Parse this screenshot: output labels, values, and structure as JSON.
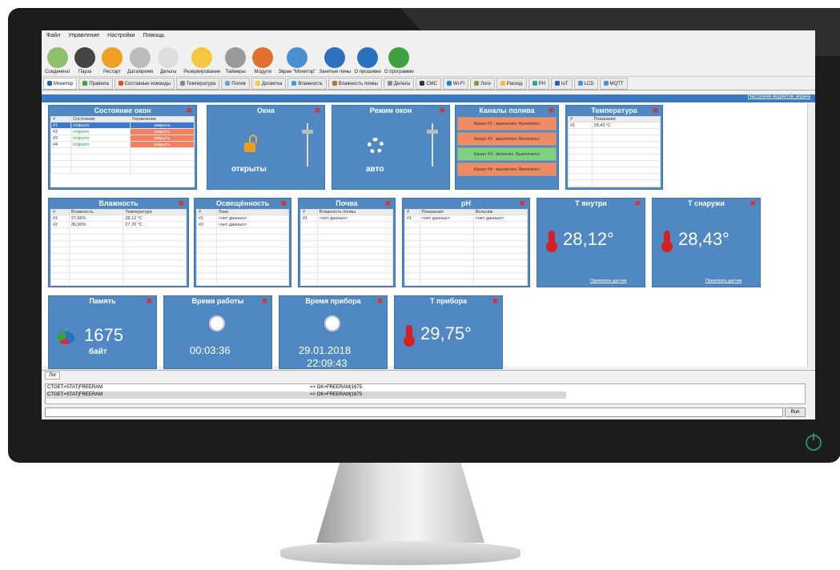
{
  "menu": [
    "Файл",
    "Управление",
    "Настройки",
    "Помощь"
  ],
  "toolbar": [
    {
      "label": "Соединено",
      "icon": "plug-icon",
      "color": "#8fbf6a"
    },
    {
      "label": "Пауза",
      "icon": "pause-icon",
      "color": "#444444"
    },
    {
      "label": "Рестарт",
      "icon": "restart-icon",
      "color": "#f0a020"
    },
    {
      "label": "Дата/время",
      "icon": "alarm-clock-icon",
      "color": "#bbbbbb"
    },
    {
      "label": "Дельты",
      "icon": "document-icon",
      "color": "#dddddd"
    },
    {
      "label": "Резервирование",
      "icon": "folder-icon",
      "color": "#f5c842"
    },
    {
      "label": "Таймеры",
      "icon": "timer-icon",
      "color": "#999999"
    },
    {
      "label": "Модули",
      "icon": "tools-icon",
      "color": "#e07030"
    },
    {
      "label": "Экран \"Монитор\"",
      "icon": "monitor-icon",
      "color": "#4a90d0"
    },
    {
      "label": "Занятые пины",
      "icon": "pin-icon",
      "color": "#3070c0"
    },
    {
      "label": "О прошивке",
      "icon": "info-icon",
      "color": "#2a70c0"
    },
    {
      "label": "О программе",
      "icon": "leaf-icon",
      "color": "#3fa040"
    }
  ],
  "tabs": [
    {
      "label": "Монитор",
      "color": "#2a5fb0"
    },
    {
      "label": "Правила",
      "color": "#40a040"
    },
    {
      "label": "Составные команды",
      "color": "#e05020"
    },
    {
      "label": "Температура",
      "color": "#888888"
    },
    {
      "label": "Полив",
      "color": "#6a9fe0"
    },
    {
      "label": "Досветка",
      "color": "#f0d030"
    },
    {
      "label": "Влажность",
      "color": "#3aa0e0"
    },
    {
      "label": "Влажность почвы",
      "color": "#b07030"
    },
    {
      "label": "Дельты",
      "color": "#888888"
    },
    {
      "label": "СМС",
      "color": "#333333"
    },
    {
      "label": "Wi-Fi",
      "color": "#2080d0"
    },
    {
      "label": "Логи",
      "color": "#80a040"
    },
    {
      "label": "Расход",
      "color": "#f0c030"
    },
    {
      "label": "PH",
      "color": "#30a0a0"
    },
    {
      "label": "IoT",
      "color": "#2060c0"
    },
    {
      "label": "LCD",
      "color": "#4a90d0"
    },
    {
      "label": "MQTT",
      "color": "#4a90d0"
    }
  ],
  "dash_link": "Настройки виджетов экрана",
  "window_state": {
    "title": "Состояние окон",
    "headers": [
      "#",
      "Состояние",
      "Управление"
    ],
    "rows": [
      [
        "#1",
        "открыто",
        "закрыть"
      ],
      [
        "#2",
        "открыто",
        "закрыть"
      ],
      [
        "#3",
        "открыто",
        "закрыть"
      ],
      [
        "#4",
        "открыто",
        "закрыть"
      ]
    ]
  },
  "windows": {
    "title": "Окна",
    "value": "открыты"
  },
  "window_mode": {
    "title": "Режим окон",
    "value": "авто"
  },
  "watering": {
    "title": "Каналы полива",
    "channels": [
      {
        "label": "Канал #1 : выключен. Включить!",
        "on": false
      },
      {
        "label": "Канал #2 : выключен. Включить!",
        "on": false
      },
      {
        "label": "Канал #3 : включен. Выключить!",
        "on": true
      },
      {
        "label": "Канал #4 : выключен. Включить!",
        "on": false
      }
    ]
  },
  "temperature": {
    "title": "Температура",
    "headers": [
      "#",
      "Показания"
    ],
    "rows": [
      [
        "#1",
        "28,43 °C"
      ]
    ]
  },
  "humidity": {
    "title": "Влажность",
    "headers": [
      "#",
      "Влажность",
      "Температура"
    ],
    "rows": [
      [
        "#1",
        "27,66%",
        "28,12 °C"
      ],
      [
        "#2",
        "36,90%",
        "27,70 °C"
      ]
    ]
  },
  "light": {
    "title": "Освещённость",
    "headers": [
      "#",
      "Люкс"
    ],
    "rows": [
      [
        "#1",
        "<нет данных>"
      ],
      [
        "#2",
        "<нет данных>"
      ]
    ]
  },
  "soil": {
    "title": "Почва",
    "headers": [
      "#",
      "Влажность почвы"
    ],
    "rows": [
      [
        "#1",
        "<нет данных>"
      ]
    ]
  },
  "ph": {
    "title": "pH",
    "headers": [
      "#",
      "Показания",
      "Вольтаж"
    ],
    "rows": [
      [
        "#1",
        "<нет данных>",
        "<нет данных>"
      ]
    ]
  },
  "t_inside": {
    "title": "Т внутри",
    "value": "28,12°",
    "link": "Привязать датчик"
  },
  "t_outside": {
    "title": "Т снаружи",
    "value": "28,43°",
    "link": "Привязать датчик"
  },
  "memory": {
    "title": "Память",
    "value": "1675",
    "unit": "байт"
  },
  "uptime": {
    "title": "Время работы",
    "value": "00:03:36"
  },
  "device_time": {
    "title": "Время прибора",
    "date": "29.01.2018",
    "time": "22:09:43"
  },
  "device_temp": {
    "title": "Т прибора",
    "value": "29,75°"
  },
  "log": {
    "tab": "Лог",
    "rows": [
      [
        "CTGET=STAT|FREERAM",
        "=> OK=FREERAM|1675"
      ],
      [
        "CTGET=STAT|FREERAM",
        "=> OK=FREERAM|1675"
      ]
    ],
    "run": "Run"
  }
}
